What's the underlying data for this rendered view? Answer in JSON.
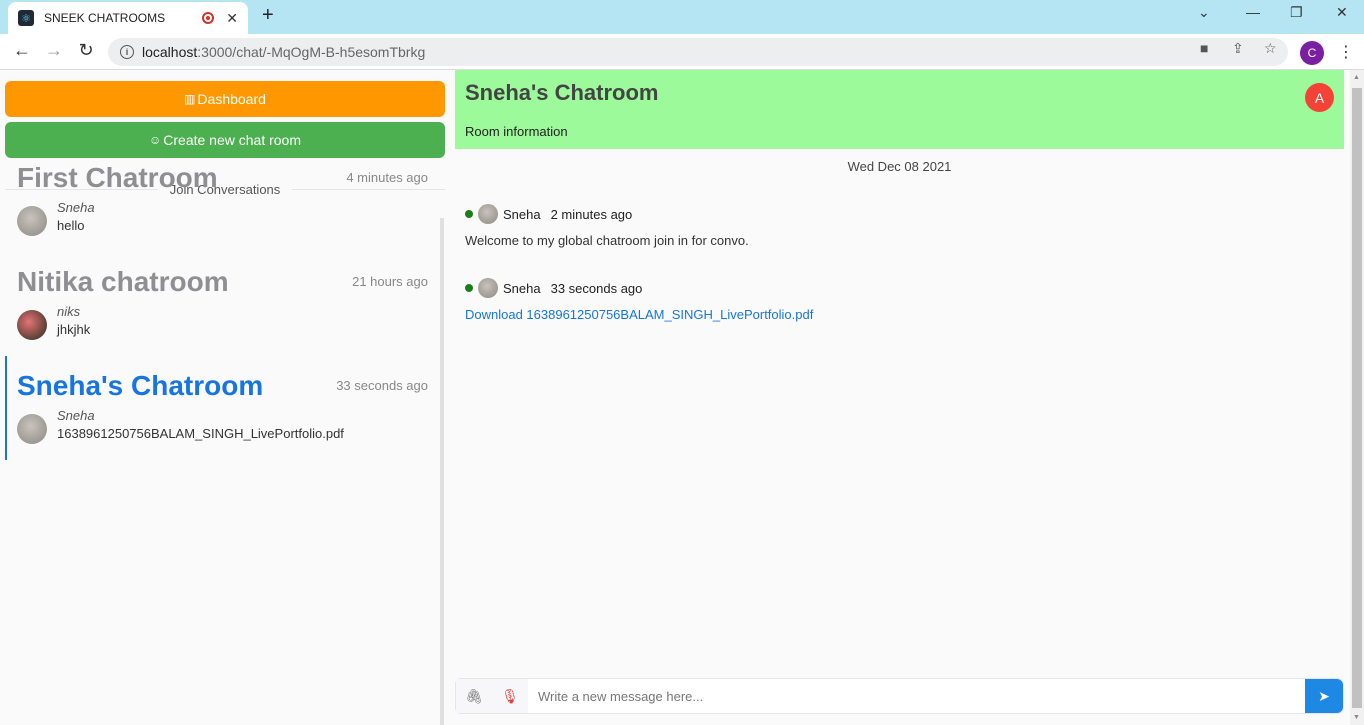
{
  "browser": {
    "tab_title": "SNEEK CHATROOMS",
    "url_host": "localhost",
    "url_path": ":3000/chat/-MqOgM-B-h5esomTbrkg",
    "profile_initial": "C"
  },
  "sidebar": {
    "dashboard_label": "Dashboard",
    "create_label": "Create new chat room",
    "divider_label": "Join Conversations",
    "rooms": [
      {
        "name": "First Chatroom",
        "time": "4 minutes ago",
        "author": "Sneha",
        "text": "hello"
      },
      {
        "name": "Nitika chatroom",
        "time": "21 hours ago",
        "author": "niks",
        "text": "jhkjhk"
      },
      {
        "name": "Sneha's Chatroom",
        "time": "33 seconds ago",
        "author": "Sneha",
        "text": "1638961250756BALAM_SINGH_LivePortfolio.pdf"
      }
    ]
  },
  "chat": {
    "title": "Sneha's Chatroom",
    "room_info": "Room information",
    "user_initial": "A",
    "date": "Wed Dec 08 2021",
    "messages": [
      {
        "user": "Sneha",
        "time": "2 minutes ago",
        "text": "Welcome to my global chatroom join in for convo."
      },
      {
        "user": "Sneha",
        "time": "33 seconds ago",
        "link": "Download 1638961250756BALAM_SINGH_LivePortfolio.pdf"
      }
    ],
    "composer_placeholder": "Write a new message here..."
  }
}
